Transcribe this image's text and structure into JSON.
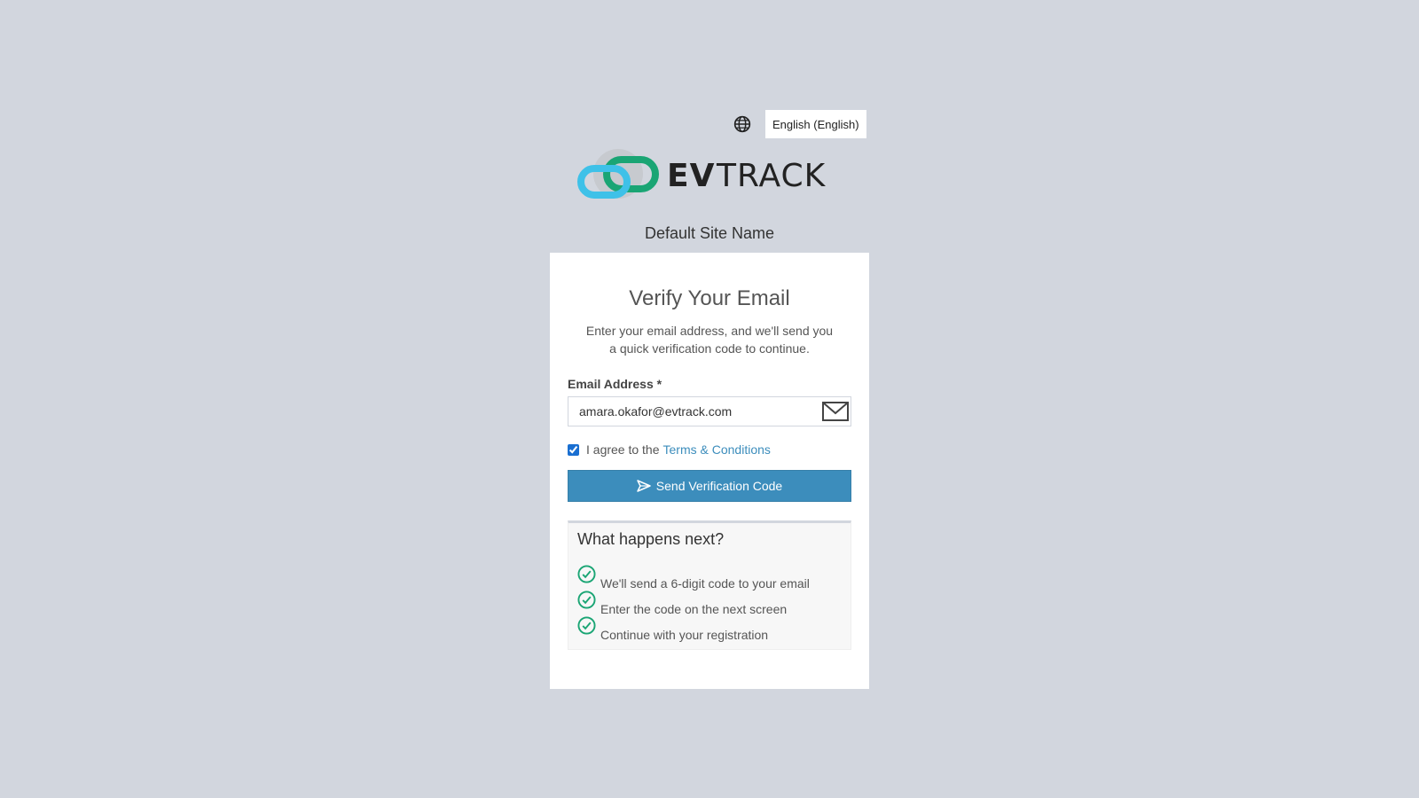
{
  "language": {
    "selected": "English (English)",
    "icon": "globe-icon"
  },
  "brand": {
    "logo_text_bold": "EV",
    "logo_text_light": "TRACK",
    "site_name": "Default Site Name",
    "colors": {
      "logo_cyan": "#3ec1e8",
      "logo_green": "#1aa574",
      "logo_gray": "#c5c8cc",
      "primary": "#3c8dbc",
      "success": "#1aa574"
    }
  },
  "card": {
    "title": "Verify Your Email",
    "description": "Enter your email address, and we'll send you a quick verification code to continue.",
    "email_label": "Email Address *",
    "email_value": "amara.okafor@evtrack.com",
    "email_icon": "mail-icon",
    "agree_text": "I agree to the",
    "agree_link": "Terms & Conditions",
    "agree_checked": true,
    "send_button": "Send Verification Code",
    "send_icon": "send-icon"
  },
  "next_steps": {
    "title": "What happens next?",
    "items": [
      "We'll send a 6-digit code to your email",
      "Enter the code on the next screen",
      "Continue with your registration"
    ],
    "icon": "check-circle-icon"
  }
}
